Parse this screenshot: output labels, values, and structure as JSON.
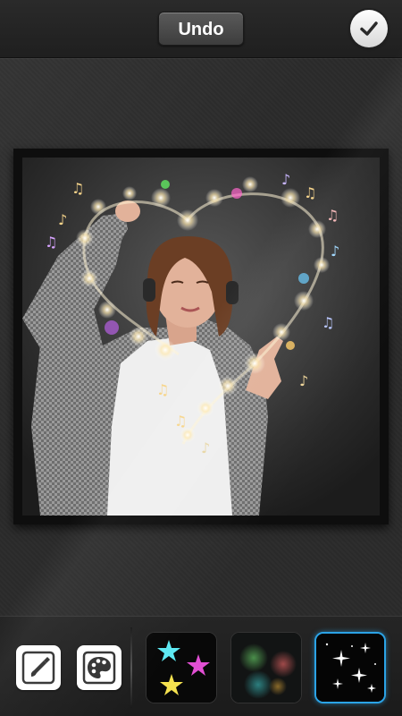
{
  "toolbar": {
    "undo_label": "Undo",
    "done_icon": "checkmark-icon"
  },
  "canvas": {
    "photo_description_icon": "photo-with-sparkle-heart-effect"
  },
  "bottom_toolbar": {
    "tools": [
      {
        "icon": "brush-icon"
      },
      {
        "icon": "palette-icon"
      }
    ],
    "effects": [
      {
        "icon": "stars-effect-icon",
        "selected": false
      },
      {
        "icon": "bokeh-effect-icon",
        "selected": false
      },
      {
        "icon": "sparkles-effect-icon",
        "selected": true
      }
    ]
  },
  "colors": {
    "accent": "#2ba3e6",
    "background": "#2b2b2b"
  }
}
